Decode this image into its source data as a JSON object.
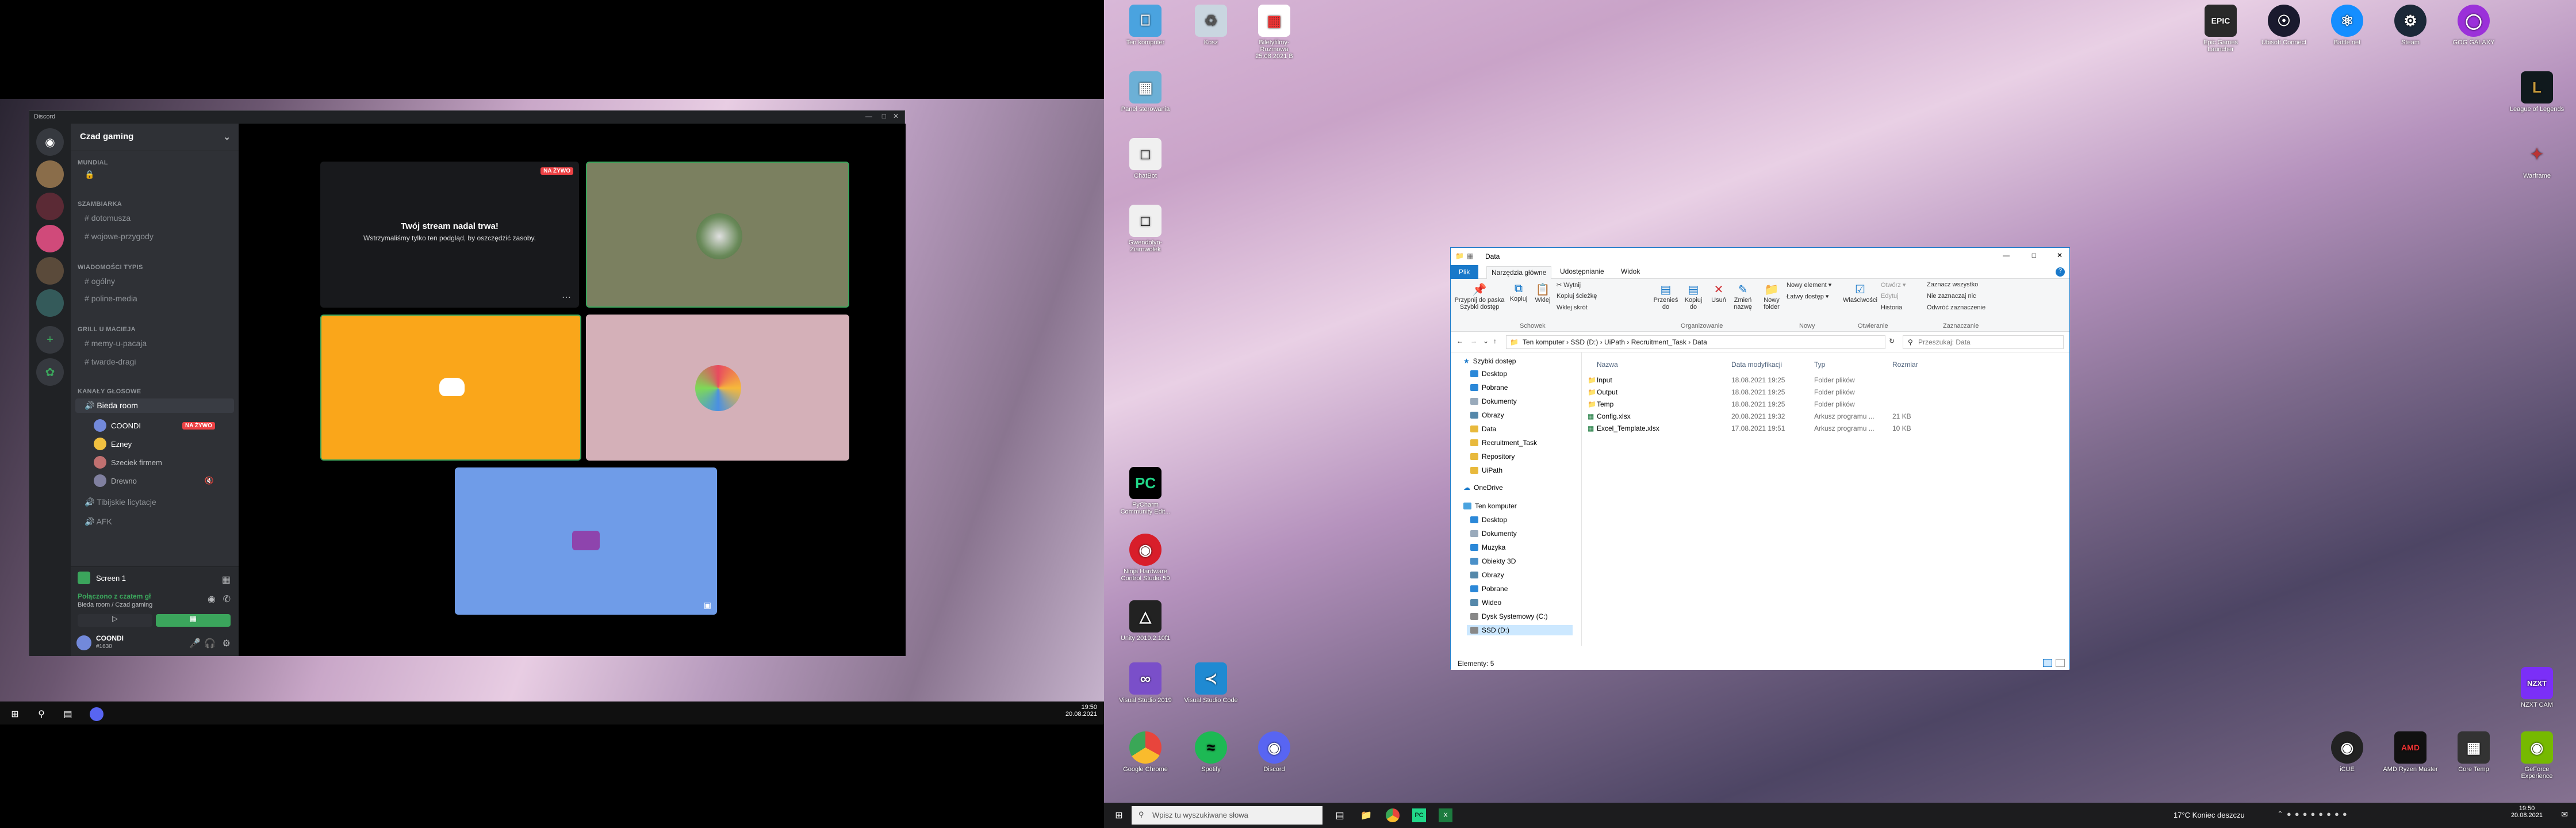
{
  "colors": {
    "discord_bg": "#202225",
    "discord_accent": "#5865f2",
    "live_red": "#ed4245",
    "green": "#3ba55c",
    "explorer_blue": "#1979ca",
    "folder_yellow": "#e8b93c"
  },
  "discord": {
    "app_title": "Discord",
    "guild": "Czad gaming",
    "categories": [
      {
        "name": "MUNDIAL",
        "channels": []
      },
      {
        "name": "SZAMBIARKA",
        "channels": [
          "dotomusza",
          "wojowe-przygody"
        ]
      },
      {
        "name": "WIADOMOŚCI TYPIS",
        "channels": [
          "ogólny",
          "poline-media"
        ]
      },
      {
        "name": "GRILL U MACIEJA",
        "channels": [
          "memy-u-pacaja",
          "twarde-dragi"
        ]
      },
      {
        "name": "KANAŁY GŁOSOWE",
        "channels": [
          "Bieda room"
        ]
      }
    ],
    "voice_users": [
      {
        "name": "COONDI",
        "badge": "NA ŻYWO"
      },
      {
        "name": "Ezney",
        "badge": ""
      },
      {
        "name": "Szeciek firmem",
        "badge": ""
      },
      {
        "name": "Drewno",
        "badge": ""
      }
    ],
    "more_channels": [
      "Tibijskie licytacje",
      "AFK"
    ],
    "voice_panel": {
      "stream_name": "Screen 1",
      "status": "Połączono z czatem gł",
      "sub": "Bieda room / Czad gaming"
    },
    "user": {
      "name": "COONDI",
      "tag": "#1630"
    },
    "stream": {
      "live_badge": "NA ŻYWO",
      "title": "Twój stream nadal trwa!",
      "subtitle": "Wstrzymaliśmy tylko ten podgląd, by oszczędzić zasoby."
    }
  },
  "left_taskbar": {
    "time": "19:50",
    "date": "20.08.2021"
  },
  "desktop_icons_left": [
    {
      "label": "Ten komputer",
      "icon": "computer-icon",
      "color": "#4aa3df"
    },
    {
      "label": "Kosz",
      "icon": "recycle-bin-icon",
      "color": "#c9d6e0"
    },
    {
      "label": "Biletyfilmy-Rozmowa 25.08.2021 B",
      "icon": "pdf-icon",
      "color": "#e33"
    },
    {
      "label": "Panel sterowania",
      "icon": "control-panel-icon",
      "color": "#6cb0d6"
    },
    {
      "label": "ChatBot",
      "icon": "file-icon",
      "color": "#f0f0f0"
    },
    {
      "label": "Gwendolyn-Ziarnwołek",
      "icon": "document-icon",
      "color": "#f0f0f0"
    },
    {
      "label": "PyCharm Community Edit...",
      "icon": "pycharm-icon",
      "color": "#21d789"
    },
    {
      "label": "Ninja Hardware Control Studio 50",
      "icon": "red-app-icon",
      "color": "#d81e2a"
    },
    {
      "label": "Unity 2019.2.10f1",
      "icon": "unity-icon",
      "color": "#222"
    },
    {
      "label": "Visual Studio 2019",
      "icon": "vs-icon",
      "color": "#7a4fc9"
    },
    {
      "label": "Visual Studio Code",
      "icon": "vscode-icon",
      "color": "#1f8ad2"
    },
    {
      "label": "Google Chrome",
      "icon": "chrome-icon",
      "color": "#e8453c"
    },
    {
      "label": "Spotify",
      "icon": "spotify-icon",
      "color": "#1db954"
    },
    {
      "label": "Discord",
      "icon": "discord-icon",
      "color": "#5865f2"
    }
  ],
  "desktop_icons_right": [
    {
      "label": "Epic Games Launcher",
      "icon": "epic-icon",
      "color": "#2a2a2a"
    },
    {
      "label": "Ubisoft Connect",
      "icon": "ubisoft-icon",
      "color": "#1a1a2e"
    },
    {
      "label": "Battle.net",
      "icon": "battlenet-icon",
      "color": "#148eff"
    },
    {
      "label": "Steam",
      "icon": "steam-icon",
      "color": "#1b2838"
    },
    {
      "label": "GOG GALAXY",
      "icon": "gog-icon",
      "color": "#9b30d9"
    },
    {
      "label": "League of Legends",
      "icon": "lol-icon",
      "color": "#c89b3c"
    },
    {
      "label": "Warframe",
      "icon": "warframe-icon",
      "color": "#b33"
    },
    {
      "label": "NZXT CAM",
      "icon": "nzxt-icon",
      "color": "#7b2ff7"
    },
    {
      "label": "iCUE",
      "icon": "icue-icon",
      "color": "#222"
    },
    {
      "label": "AMD Ryzen Master",
      "icon": "amd-icon",
      "color": "#111"
    },
    {
      "label": "Core Temp",
      "icon": "coretemp-icon",
      "color": "#333"
    },
    {
      "label": "GeForce Experience",
      "icon": "geforce-icon",
      "color": "#76b900"
    }
  ],
  "explorer": {
    "window_title": "Data",
    "tabs": [
      "Plik",
      "Narzędzia główne",
      "Udostępnianie",
      "Widok"
    ],
    "ribbon": {
      "groups": [
        "Schowek",
        "Organizowanie",
        "Nowy",
        "Otwieranie",
        "Zaznaczanie"
      ],
      "buttons": [
        "Przypnij do paska Szybki dostęp",
        "Kopiuj",
        "Wklej",
        "Wytnij",
        "Kopiuj ścieżkę",
        "Wklej skrót",
        "Przenieś do",
        "Kopiuj do",
        "Usuń",
        "Zmień nazwę",
        "Nowy folder",
        "Nowy element",
        "Łatwy dostęp",
        "Właściwości",
        "Otwórz",
        "Edytuj",
        "Historia",
        "Zaznacz wszystko",
        "Nie zaznaczaj nic",
        "Odwróć zaznaczenie"
      ]
    },
    "breadcrumb": [
      "Ten komputer",
      "SSD (D:)",
      "UiPath",
      "Recruitment_Task",
      "Data"
    ],
    "search_placeholder": "Przeszukaj: Data",
    "nav": [
      "Szybki dostęp",
      "Desktop",
      "Pobrane",
      "Dokumenty",
      "Obrazy",
      "Data",
      "Recruitment_Task",
      "Repository",
      "UiPath",
      "OneDrive",
      "Ten komputer",
      "Desktop",
      "Dokumenty",
      "Muzyka",
      "Obiekty 3D",
      "Obrazy",
      "Pobrane",
      "Wideo",
      "Dysk Systemowy (C:)",
      "SSD (D:)"
    ],
    "columns": [
      "Nazwa",
      "Data modyfikacji",
      "Typ",
      "Rozmiar"
    ],
    "files": [
      {
        "name": "Input",
        "date": "18.08.2021 19:25",
        "type": "Folder plików",
        "size": ""
      },
      {
        "name": "Output",
        "date": "18.08.2021 19:25",
        "type": "Folder plików",
        "size": ""
      },
      {
        "name": "Temp",
        "date": "18.08.2021 19:25",
        "type": "Folder plików",
        "size": ""
      },
      {
        "name": "Config.xlsx",
        "date": "20.08.2021 19:32",
        "type": "Arkusz programu ...",
        "size": "21 KB"
      },
      {
        "name": "Excel_Template.xlsx",
        "date": "17.08.2021 19:51",
        "type": "Arkusz programu ...",
        "size": "10 KB"
      }
    ],
    "status": "Elementy: 5"
  },
  "right_taskbar": {
    "search_placeholder": "Wpisz tu wyszukiwane słowa",
    "weather": "17°C  Koniec deszczu",
    "time": "19:50",
    "date": "20.08.2021"
  }
}
